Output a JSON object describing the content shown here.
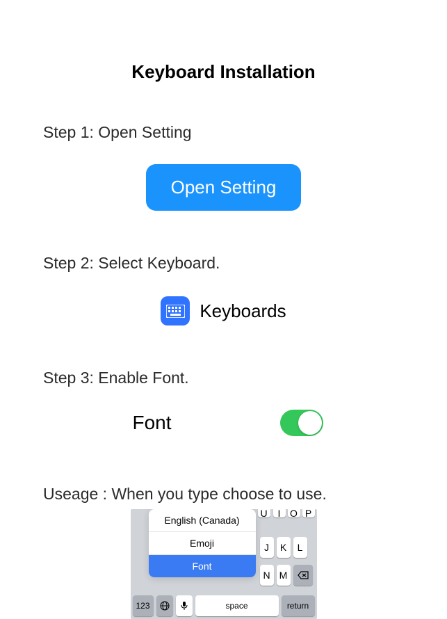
{
  "title": "Keyboard Installation",
  "steps": {
    "s1": {
      "label": "Step 1: Open Setting",
      "button": "Open Setting"
    },
    "s2": {
      "label": "Step 2: Select Keyboard.",
      "item": "Keyboards"
    },
    "s3": {
      "label": "Step 3: Enable Font.",
      "item": "Font",
      "enabled": true
    }
  },
  "usage": {
    "label": "Useage : When you type choose to use.",
    "menu": [
      "English (Canada)",
      "Emoji",
      "Font"
    ],
    "selected": "Font",
    "top_row": [
      "U",
      "I",
      "O",
      "P"
    ],
    "row2": [
      "J",
      "K",
      "L"
    ],
    "row3": [
      "N",
      "M"
    ],
    "bottom": {
      "num": "123",
      "space": "space",
      "return": "return"
    }
  },
  "colors": {
    "accent": "#1b93fd",
    "toggle_on": "#34c759",
    "menu_selected": "#3a7af3"
  }
}
